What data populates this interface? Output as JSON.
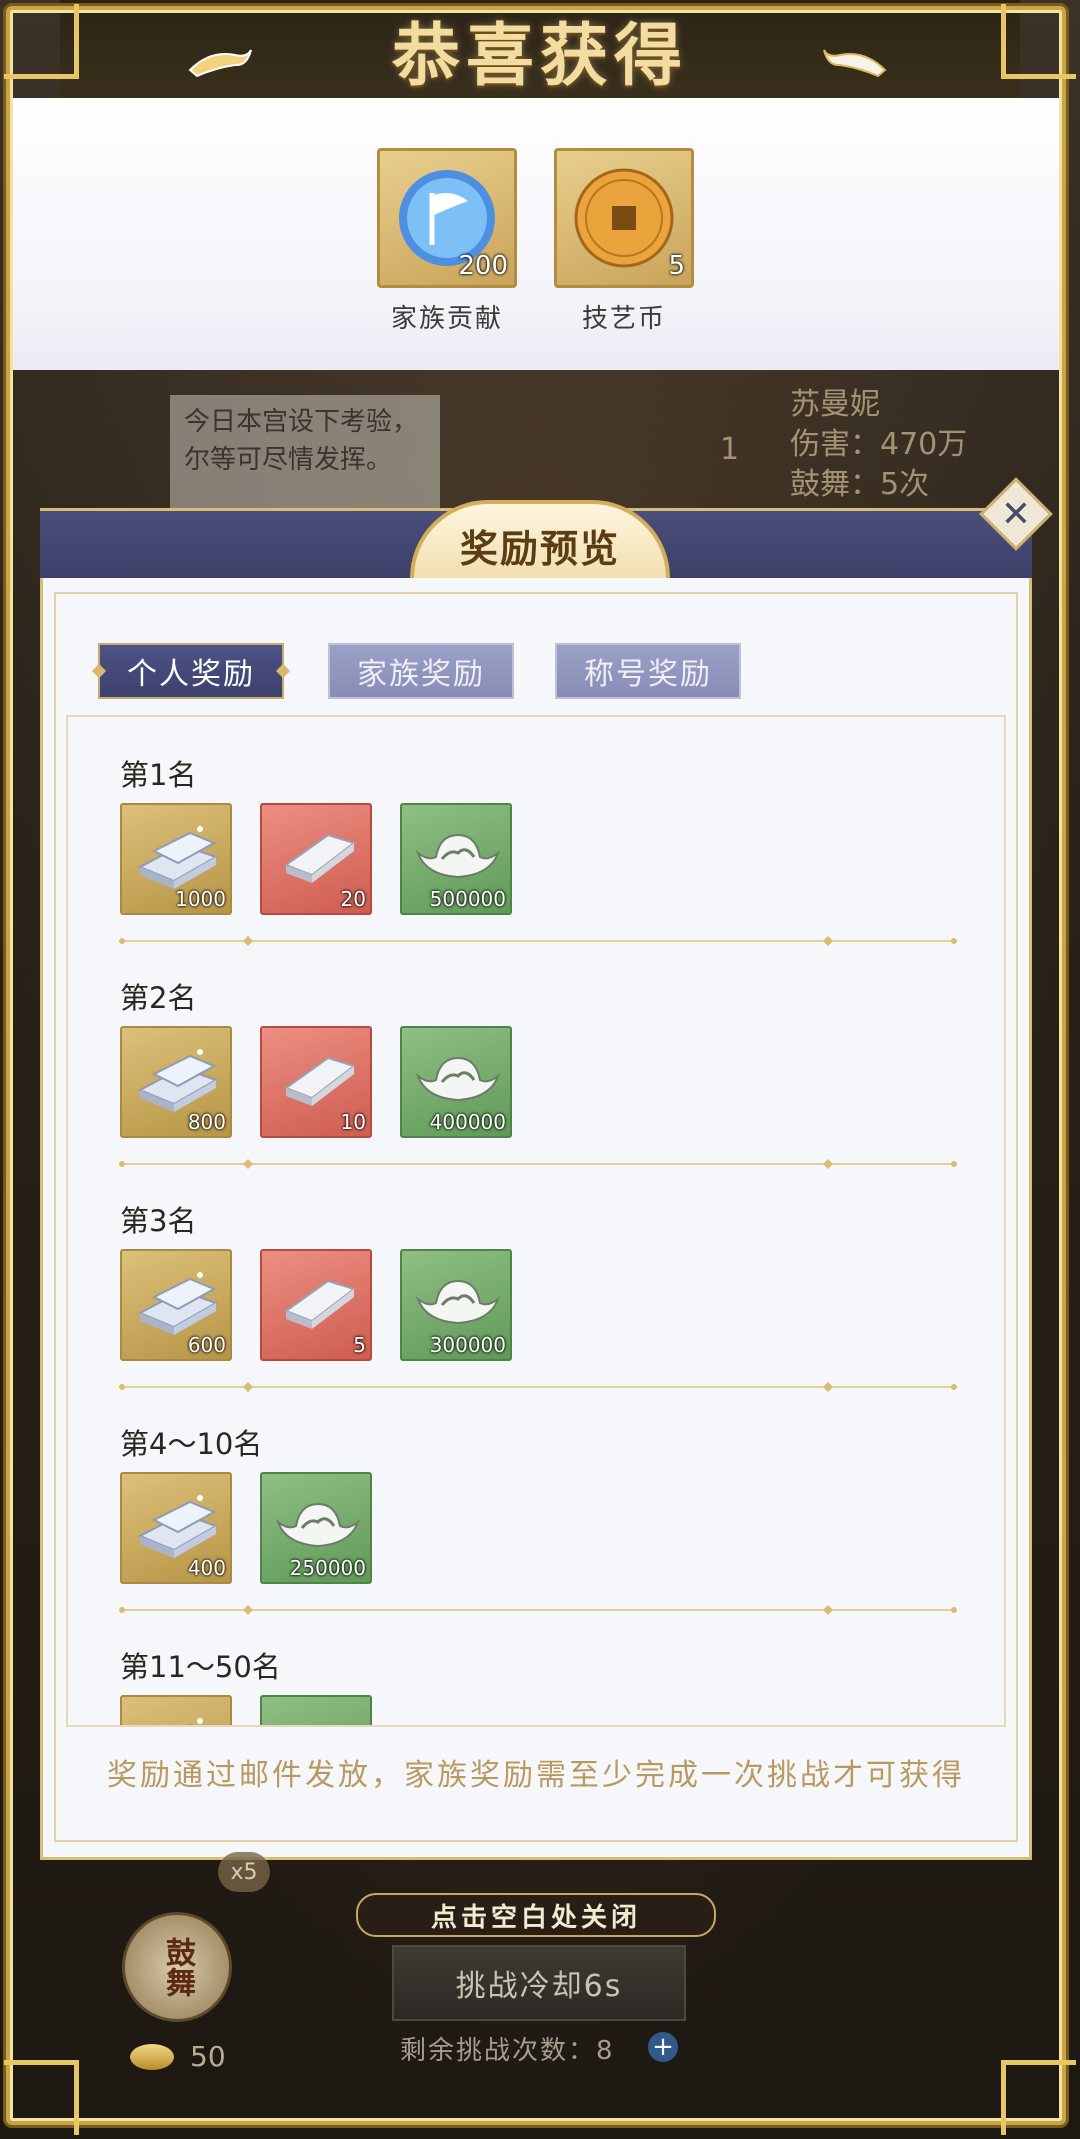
{
  "congrats": {
    "title": "恭喜获得",
    "items": [
      {
        "icon": "flag-orb-icon",
        "count": "200",
        "label": "家族贡献"
      },
      {
        "icon": "copper-coin-icon",
        "count": "5",
        "label": "技艺币"
      }
    ]
  },
  "background": {
    "speech_text": "今日本宫设下考验，尔等可尽情发挥。",
    "rank_num": "1",
    "rank_lines": [
      "苏曼妮",
      "伤害：470万",
      "鼓舞：5次"
    ],
    "close_hint": "点击空白处关闭",
    "cooldown": "挑战冷却6s",
    "remaining": "剩余挑战次数：8",
    "drum_label": "鼓舞",
    "x5": "x5",
    "coin_count": "50"
  },
  "modal": {
    "title": "奖励预览",
    "tabs": [
      "个人奖励",
      "家族奖励",
      "称号奖励"
    ],
    "active_tab": 0,
    "tiers": [
      {
        "label": "第1名",
        "items": [
          {
            "type": "silver-bars-icon",
            "bg": "gold",
            "qty": "1000"
          },
          {
            "type": "silver-ingot-icon",
            "bg": "red",
            "qty": "20"
          },
          {
            "type": "sycee-icon",
            "bg": "green",
            "qty": "500000"
          }
        ]
      },
      {
        "label": "第2名",
        "items": [
          {
            "type": "silver-bars-icon",
            "bg": "gold",
            "qty": "800"
          },
          {
            "type": "silver-ingot-icon",
            "bg": "red",
            "qty": "10"
          },
          {
            "type": "sycee-icon",
            "bg": "green",
            "qty": "400000"
          }
        ]
      },
      {
        "label": "第3名",
        "items": [
          {
            "type": "silver-bars-icon",
            "bg": "gold",
            "qty": "600"
          },
          {
            "type": "silver-ingot-icon",
            "bg": "red",
            "qty": "5"
          },
          {
            "type": "sycee-icon",
            "bg": "green",
            "qty": "300000"
          }
        ]
      },
      {
        "label": "第4～10名",
        "items": [
          {
            "type": "silver-bars-icon",
            "bg": "gold",
            "qty": "400"
          },
          {
            "type": "sycee-icon",
            "bg": "green",
            "qty": "250000"
          }
        ]
      },
      {
        "label": "第11～50名",
        "items": [
          {
            "type": "silver-bars-icon",
            "bg": "gold",
            "qty": ""
          },
          {
            "type": "sycee-icon",
            "bg": "green",
            "qty": ""
          }
        ]
      }
    ],
    "footer_note": "奖励通过邮件发放，家族奖励需至少完成一次挑战才可获得"
  },
  "colors": {
    "frame_gold": "#c9a54a",
    "tab_active": "#4e5287",
    "tab_inactive": "#9aa0c6",
    "gold_slot": "#dcc07a",
    "red_slot": "#ec8f82",
    "green_slot": "#8fbf84"
  }
}
